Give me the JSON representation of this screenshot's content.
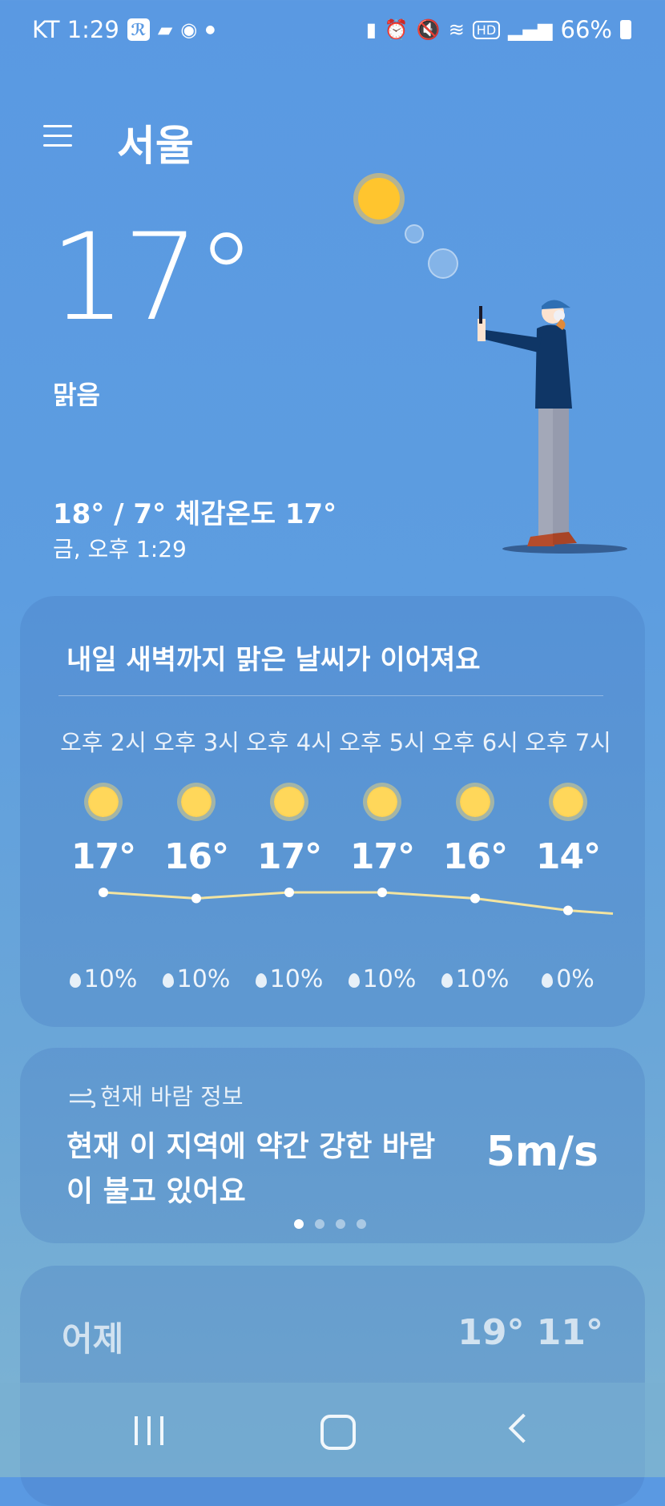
{
  "status_bar": {
    "carrier_time": "KT 1:29",
    "battery": "66%"
  },
  "header": {
    "city": "서울"
  },
  "current": {
    "temperature": "17°",
    "condition": "맑음",
    "hi_lo_feels": "18° / 7° 체감온도 17°",
    "datetime": "금, 오후 1:29"
  },
  "hourly": {
    "summary": "내일 새벽까지 맑은 날씨가 이어져요",
    "hours": [
      {
        "label": "오후 2시",
        "temp": "17°",
        "rain": "10%",
        "icon": "sun-icon"
      },
      {
        "label": "오후 3시",
        "temp": "16°",
        "rain": "10%",
        "icon": "sun-icon"
      },
      {
        "label": "오후 4시",
        "temp": "17°",
        "rain": "10%",
        "icon": "sun-icon"
      },
      {
        "label": "오후 5시",
        "temp": "17°",
        "rain": "10%",
        "icon": "sun-icon"
      },
      {
        "label": "오후 6시",
        "temp": "16°",
        "rain": "10%",
        "icon": "sun-icon"
      },
      {
        "label": "오후 7시",
        "temp": "14°",
        "rain": "0%",
        "icon": "sun-icon"
      }
    ]
  },
  "wind": {
    "label": "현재 바람 정보",
    "message": "현재 이 지역에 약간 강한 바람이 불고 있어요",
    "speed": "5m/s",
    "page_count": 4,
    "active_page": 1
  },
  "yesterday": {
    "label": "어제",
    "temps": "19° 11°"
  },
  "colors": {
    "background": "#5a99e2",
    "sun": "#ffc52e"
  }
}
